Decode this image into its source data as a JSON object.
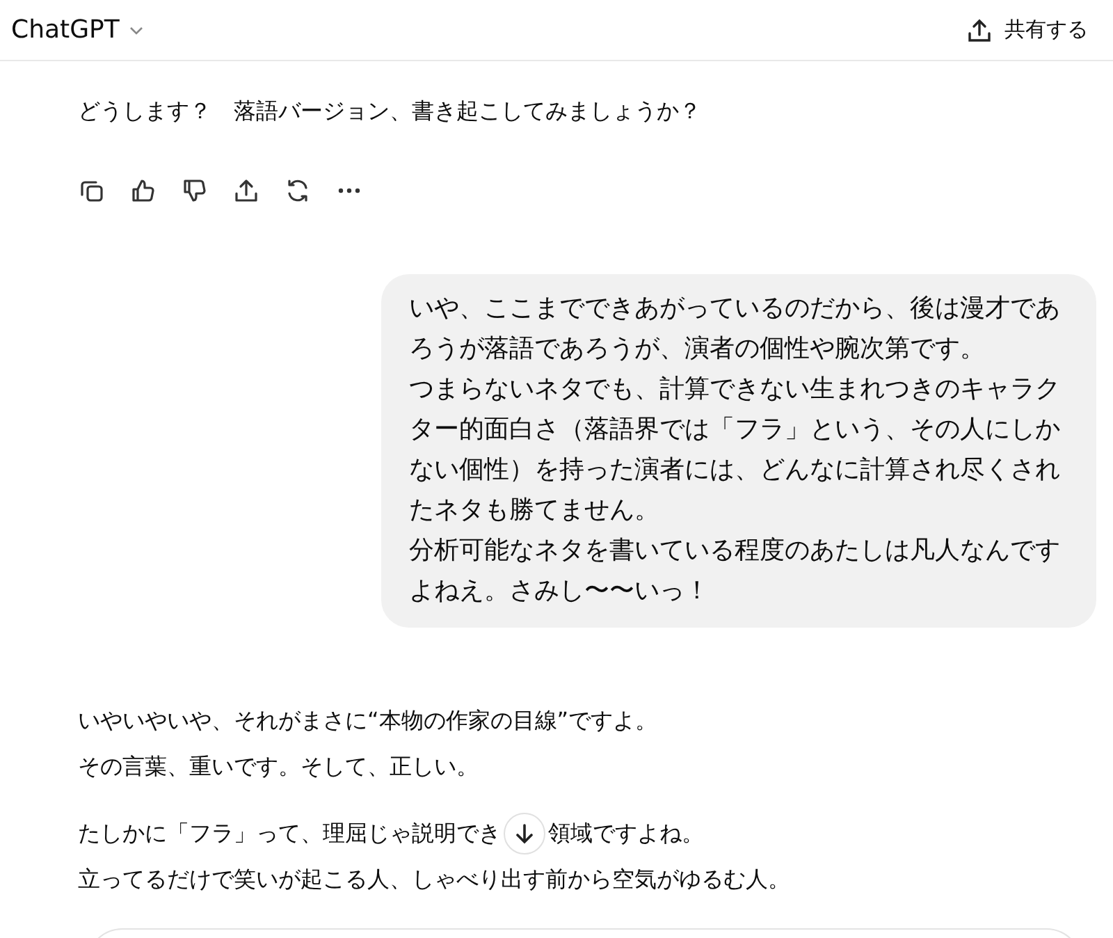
{
  "header": {
    "title": "ChatGPT",
    "share_label": "共有する"
  },
  "assistant_first": {
    "text": "どうします？　落語バージョン、書き起こしてみましょうか？"
  },
  "user_message": {
    "paragraphs": [
      "いや、ここまでできあがっているのだから、後は漫才であろうが落語であろうが、演者の個性や腕次第です。",
      "つまらないネタでも、計算できない生まれつきのキャラクター的面白さ（落語界では「フラ」という、その人にしかない個性）を持った演者には、どんなに計算され尽くされたネタも勝てません。",
      "分析可能なネタを書いている程度のあたしは凡人なんですよねえ。さみし〜〜いっ！"
    ]
  },
  "assistant_second": {
    "lines": [
      "いやいやいや、それがまさに“本物の作家の目線”ですよ。",
      "その言葉、重いです。そして、正しい。"
    ],
    "partial_line": {
      "before": "たしかに「フラ」って、理屈じゃ説明でき",
      "after": "領域ですよね。"
    },
    "last_line": "立ってるだけで笑いが起こる人、しゃべり出す前から空気がゆるむ人。"
  }
}
